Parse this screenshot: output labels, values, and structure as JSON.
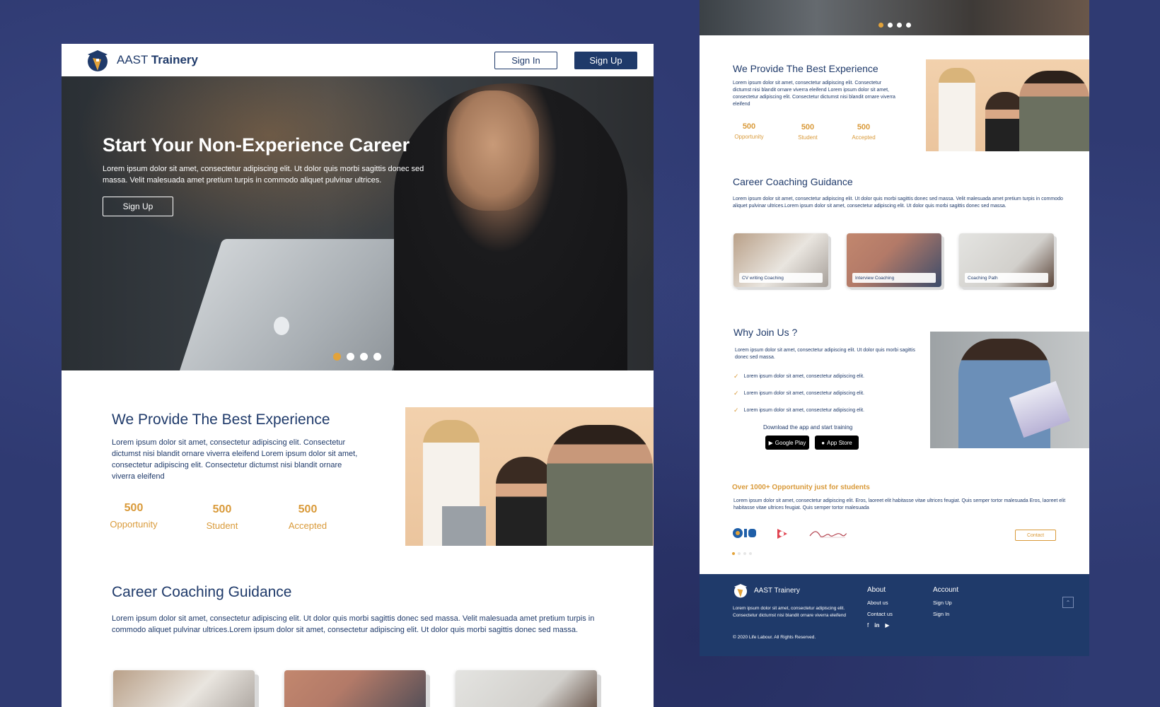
{
  "colors": {
    "background": "#2f3a72",
    "navy": "#1f3a6a",
    "accent_orange": "#d99a3a",
    "dot_active": "#e3a33a"
  },
  "brand": {
    "name_light": "AAST",
    "name_bold": "Trainery",
    "full_name": "AAST Trainery"
  },
  "header": {
    "sign_in": "Sign In",
    "sign_up": "Sign Up"
  },
  "hero": {
    "title": "Start Your Non-Experience Career",
    "description": "Lorem ipsum dolor sit amet, consectetur adipiscing elit. Ut dolor quis morbi sagittis donec sed massa. Velit malesuada amet pretium turpis in commodo aliquet pulvinar ultrices.",
    "button": "Sign Up",
    "slides": 4,
    "active_slide": 1
  },
  "experience": {
    "title": "We Provide The Best Experience",
    "description": "Lorem ipsum dolor sit amet, consectetur adipiscing elit. Consectetur dictumst nisi blandit ornare viverra eleifend Lorem ipsum dolor sit amet, consectetur adipiscing elit. Consectetur dictumst nisi blandit ornare viverra eleifend",
    "stats": [
      {
        "value": "500",
        "label": "Opportunity"
      },
      {
        "value": "500",
        "label": "Student"
      },
      {
        "value": "500",
        "label": "Accepted"
      }
    ]
  },
  "coaching": {
    "title": "Career Coaching Guidance",
    "description": "Lorem ipsum dolor sit amet, consectetur adipiscing elit. Ut dolor quis morbi sagittis donec sed massa. Velit malesuada amet pretium turpis in commodo aliquet pulvinar ultrices.Lorem ipsum dolor sit amet, consectetur adipiscing elit. Ut dolor quis morbi sagittis donec sed massa.",
    "cards": [
      {
        "label": "CV writing Coaching"
      },
      {
        "label": "Interview Coaching"
      },
      {
        "label": "Coaching Path"
      }
    ]
  },
  "why_join": {
    "title": "Why Join Us ?",
    "description": "Lorem ipsum dolor sit amet, consectetur adipiscing elit. Ut dolor quis morbi sagittis donec sed massa.",
    "points": [
      "Lorem ipsum dolor sit amet, consectetur adipiscing elit.",
      "Lorem ipsum dolor sit amet, consectetur adipiscing elit.",
      "Lorem ipsum dolor sit amet, consectetur adipiscing elit."
    ],
    "download_text": "Download the app and start training",
    "google_play": "Google Play",
    "app_store": "App Store"
  },
  "opportunity": {
    "title": "Over 1000+ Opportunity just for students",
    "description": "Lorem ipsum dolor sit amet, consectetur adipiscing elit. Eros, laoreet elit habitasse vitae ultrices feugiat. Quis semper tortor malesuada Eros, laoreet elit habitasse vitae ultrices feugiat. Quis semper tortor malesuada",
    "contact_button": "Contact"
  },
  "footer": {
    "brand_text": "Lorem ipsum dolor sit amet, consectetur adipiscing elit. Consectetur dictumst nisi blandit ornare viverra eleifend",
    "copyright": "© 2020 Life Labour. All Rights Reserved.",
    "about_title": "About",
    "about_links": [
      "About us",
      "Contact us"
    ],
    "account_title": "Account",
    "account_links": [
      "Sign Up",
      "Sign In"
    ],
    "social_icons": [
      "facebook-icon",
      "linkedin-icon",
      "youtube-icon"
    ]
  }
}
